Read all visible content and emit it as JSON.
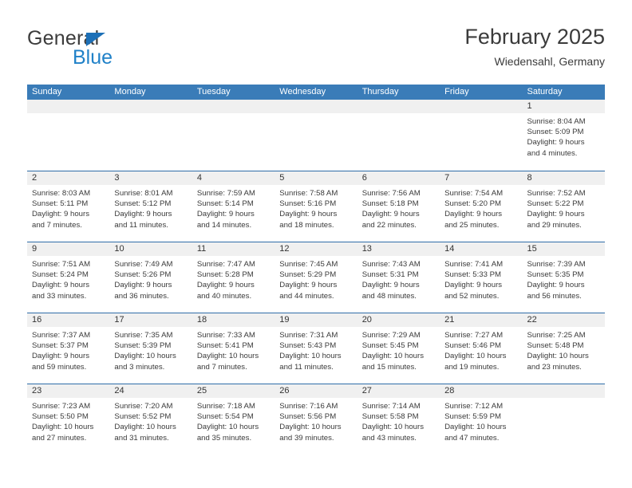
{
  "brand": {
    "name_top": "General",
    "name_bottom": "Blue",
    "accent_color": "#2081c8",
    "triangle_color": "#1d70b7"
  },
  "header": {
    "title": "February 2025",
    "subtitle": "Wiedensahl, Germany"
  },
  "theme": {
    "header_row_bg": "#3a7cb8",
    "week_divider": "#2f6da8",
    "daynum_bg": "#f0f0f0",
    "text": "#3a3a3a"
  },
  "calendar": {
    "day_headers": [
      "Sunday",
      "Monday",
      "Tuesday",
      "Wednesday",
      "Thursday",
      "Friday",
      "Saturday"
    ],
    "weeks": [
      [
        {
          "day": "",
          "lines": []
        },
        {
          "day": "",
          "lines": []
        },
        {
          "day": "",
          "lines": []
        },
        {
          "day": "",
          "lines": []
        },
        {
          "day": "",
          "lines": []
        },
        {
          "day": "",
          "lines": []
        },
        {
          "day": "1",
          "lines": [
            "Sunrise: 8:04 AM",
            "Sunset: 5:09 PM",
            "Daylight: 9 hours",
            "and 4 minutes."
          ]
        }
      ],
      [
        {
          "day": "2",
          "lines": [
            "Sunrise: 8:03 AM",
            "Sunset: 5:11 PM",
            "Daylight: 9 hours",
            "and 7 minutes."
          ]
        },
        {
          "day": "3",
          "lines": [
            "Sunrise: 8:01 AM",
            "Sunset: 5:12 PM",
            "Daylight: 9 hours",
            "and 11 minutes."
          ]
        },
        {
          "day": "4",
          "lines": [
            "Sunrise: 7:59 AM",
            "Sunset: 5:14 PM",
            "Daylight: 9 hours",
            "and 14 minutes."
          ]
        },
        {
          "day": "5",
          "lines": [
            "Sunrise: 7:58 AM",
            "Sunset: 5:16 PM",
            "Daylight: 9 hours",
            "and 18 minutes."
          ]
        },
        {
          "day": "6",
          "lines": [
            "Sunrise: 7:56 AM",
            "Sunset: 5:18 PM",
            "Daylight: 9 hours",
            "and 22 minutes."
          ]
        },
        {
          "day": "7",
          "lines": [
            "Sunrise: 7:54 AM",
            "Sunset: 5:20 PM",
            "Daylight: 9 hours",
            "and 25 minutes."
          ]
        },
        {
          "day": "8",
          "lines": [
            "Sunrise: 7:52 AM",
            "Sunset: 5:22 PM",
            "Daylight: 9 hours",
            "and 29 minutes."
          ]
        }
      ],
      [
        {
          "day": "9",
          "lines": [
            "Sunrise: 7:51 AM",
            "Sunset: 5:24 PM",
            "Daylight: 9 hours",
            "and 33 minutes."
          ]
        },
        {
          "day": "10",
          "lines": [
            "Sunrise: 7:49 AM",
            "Sunset: 5:26 PM",
            "Daylight: 9 hours",
            "and 36 minutes."
          ]
        },
        {
          "day": "11",
          "lines": [
            "Sunrise: 7:47 AM",
            "Sunset: 5:28 PM",
            "Daylight: 9 hours",
            "and 40 minutes."
          ]
        },
        {
          "day": "12",
          "lines": [
            "Sunrise: 7:45 AM",
            "Sunset: 5:29 PM",
            "Daylight: 9 hours",
            "and 44 minutes."
          ]
        },
        {
          "day": "13",
          "lines": [
            "Sunrise: 7:43 AM",
            "Sunset: 5:31 PM",
            "Daylight: 9 hours",
            "and 48 minutes."
          ]
        },
        {
          "day": "14",
          "lines": [
            "Sunrise: 7:41 AM",
            "Sunset: 5:33 PM",
            "Daylight: 9 hours",
            "and 52 minutes."
          ]
        },
        {
          "day": "15",
          "lines": [
            "Sunrise: 7:39 AM",
            "Sunset: 5:35 PM",
            "Daylight: 9 hours",
            "and 56 minutes."
          ]
        }
      ],
      [
        {
          "day": "16",
          "lines": [
            "Sunrise: 7:37 AM",
            "Sunset: 5:37 PM",
            "Daylight: 9 hours",
            "and 59 minutes."
          ]
        },
        {
          "day": "17",
          "lines": [
            "Sunrise: 7:35 AM",
            "Sunset: 5:39 PM",
            "Daylight: 10 hours",
            "and 3 minutes."
          ]
        },
        {
          "day": "18",
          "lines": [
            "Sunrise: 7:33 AM",
            "Sunset: 5:41 PM",
            "Daylight: 10 hours",
            "and 7 minutes."
          ]
        },
        {
          "day": "19",
          "lines": [
            "Sunrise: 7:31 AM",
            "Sunset: 5:43 PM",
            "Daylight: 10 hours",
            "and 11 minutes."
          ]
        },
        {
          "day": "20",
          "lines": [
            "Sunrise: 7:29 AM",
            "Sunset: 5:45 PM",
            "Daylight: 10 hours",
            "and 15 minutes."
          ]
        },
        {
          "day": "21",
          "lines": [
            "Sunrise: 7:27 AM",
            "Sunset: 5:46 PM",
            "Daylight: 10 hours",
            "and 19 minutes."
          ]
        },
        {
          "day": "22",
          "lines": [
            "Sunrise: 7:25 AM",
            "Sunset: 5:48 PM",
            "Daylight: 10 hours",
            "and 23 minutes."
          ]
        }
      ],
      [
        {
          "day": "23",
          "lines": [
            "Sunrise: 7:23 AM",
            "Sunset: 5:50 PM",
            "Daylight: 10 hours",
            "and 27 minutes."
          ]
        },
        {
          "day": "24",
          "lines": [
            "Sunrise: 7:20 AM",
            "Sunset: 5:52 PM",
            "Daylight: 10 hours",
            "and 31 minutes."
          ]
        },
        {
          "day": "25",
          "lines": [
            "Sunrise: 7:18 AM",
            "Sunset: 5:54 PM",
            "Daylight: 10 hours",
            "and 35 minutes."
          ]
        },
        {
          "day": "26",
          "lines": [
            "Sunrise: 7:16 AM",
            "Sunset: 5:56 PM",
            "Daylight: 10 hours",
            "and 39 minutes."
          ]
        },
        {
          "day": "27",
          "lines": [
            "Sunrise: 7:14 AM",
            "Sunset: 5:58 PM",
            "Daylight: 10 hours",
            "and 43 minutes."
          ]
        },
        {
          "day": "28",
          "lines": [
            "Sunrise: 7:12 AM",
            "Sunset: 5:59 PM",
            "Daylight: 10 hours",
            "and 47 minutes."
          ]
        },
        {
          "day": "",
          "lines": []
        }
      ]
    ]
  }
}
